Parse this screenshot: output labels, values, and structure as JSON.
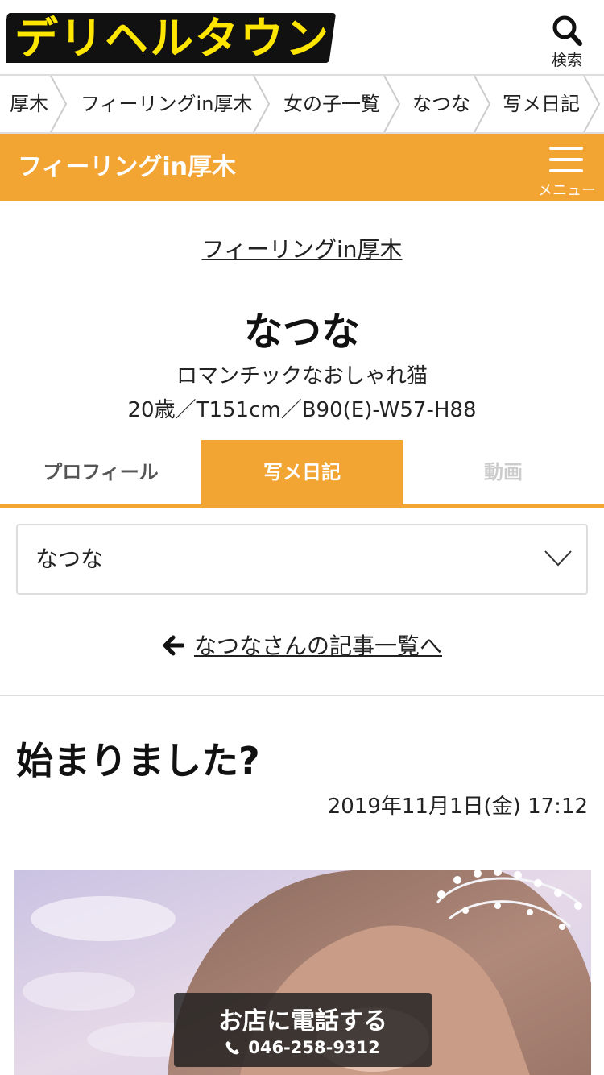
{
  "header": {
    "logo_text": "デリヘルタウン",
    "search_label": "検索"
  },
  "breadcrumb": [
    "厚木",
    "フィーリングin厚木",
    "女の子一覧",
    "なつな",
    "写メ日記"
  ],
  "shop_bar": {
    "title": "フィーリングin厚木",
    "menu_label": "メニュー"
  },
  "profile": {
    "shop_link": "フィーリングin厚木",
    "name": "なつな",
    "catchphrase": "ロマンチックなおしゃれ猫",
    "spec": "20歳／T151cm／B90(E)-W57-H88"
  },
  "tabs": [
    {
      "label": "プロフィール",
      "active": false
    },
    {
      "label": "写メ日記",
      "active": true
    },
    {
      "label": "動画",
      "active": false
    }
  ],
  "select": {
    "value": "なつな"
  },
  "back_link": "なつなさんの記事一覧へ",
  "article": {
    "title": "始まりました?",
    "date": "2019年11月1日(金) 17:12"
  },
  "call": {
    "label": "お店に電話する",
    "phone": "046-258-9312"
  },
  "colors": {
    "accent": "#f3a534",
    "logo_yellow": "#ffe600"
  },
  "icons": {
    "search": "search-icon",
    "menu": "hamburger-icon",
    "back": "arrow-left-icon",
    "dropdown": "chevron-down-icon",
    "phone": "phone-icon"
  }
}
